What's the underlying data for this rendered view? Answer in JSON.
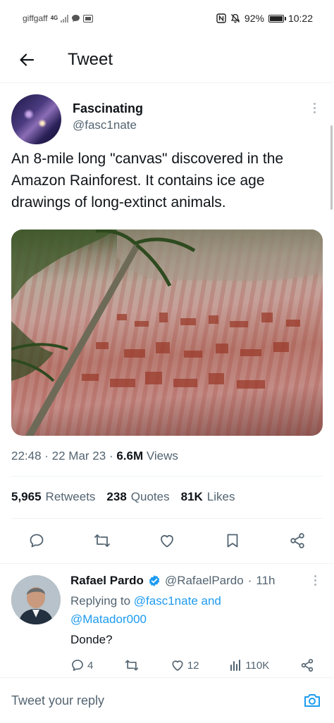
{
  "status_bar": {
    "carrier": "giffgaff",
    "network": "4G",
    "battery": "92%",
    "time": "10:22"
  },
  "header": {
    "title": "Tweet"
  },
  "tweet": {
    "author_name": "Fascinating",
    "author_handle": "@fasc1nate",
    "text": "An 8-mile long \"canvas\" discovered in the Amazon Rainforest. It contains ice age drawings of long-extinct animals.",
    "time": "22:48",
    "date": "22 Mar 23",
    "views_count": "6.6M",
    "views_label": "Views",
    "retweets_count": "5,965",
    "retweets_label": "Retweets",
    "quotes_count": "238",
    "quotes_label": "Quotes",
    "likes_count": "81K",
    "likes_label": "Likes"
  },
  "reply": {
    "author_name": "Rafael Pardo",
    "author_handle": "@RafaelPardo",
    "time": "11h",
    "replying_prefix": "Replying to",
    "replying_mentions": "@fasc1nate and @Matador000",
    "text": "Donde?",
    "reply_count": "4",
    "like_count": "12",
    "views_count": "110K"
  },
  "composer": {
    "placeholder": "Tweet your reply"
  },
  "colors": {
    "accent": "#1d9bf0",
    "text_primary": "#0f1419",
    "text_secondary": "#536471"
  }
}
